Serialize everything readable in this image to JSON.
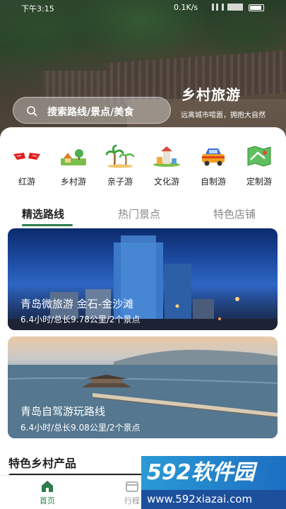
{
  "status_bar": {
    "time": "下午3:15",
    "network": "0.1K/s"
  },
  "hero": {
    "title": "乡村旅游",
    "subtitle": "远离城市喧嚣，拥抱大自然"
  },
  "search": {
    "placeholder": "搜索路线/景点/美食"
  },
  "categories": [
    {
      "label": "红游",
      "icon": "red-tour-icon"
    },
    {
      "label": "乡村游",
      "icon": "village-icon"
    },
    {
      "label": "亲子游",
      "icon": "palm-tree-icon"
    },
    {
      "label": "文化游",
      "icon": "culture-icon"
    },
    {
      "label": "自制游",
      "icon": "car-icon"
    },
    {
      "label": "定制游",
      "icon": "map-icon"
    }
  ],
  "tabs": [
    {
      "label": "精选路线",
      "active": true
    },
    {
      "label": "热门景点",
      "active": false
    },
    {
      "label": "特色店铺",
      "active": false
    }
  ],
  "routes": [
    {
      "title": "青岛微旅游 金石-金沙滩",
      "meta": "6.4小时/总长9.78公里/2个景点"
    },
    {
      "title": "青岛自驾游玩路线",
      "meta": "6.4小时/总长9.08公里/2个景点"
    }
  ],
  "section": {
    "title": "特色乡村产品"
  },
  "tabbar": [
    {
      "label": "首页",
      "icon": "home-icon",
      "active": true
    },
    {
      "label": "行程",
      "icon": "itinerary-icon",
      "active": false
    }
  ],
  "watermark": {
    "brand": "592软件园",
    "url": "www.592xiazai.com"
  },
  "colors": {
    "accent": "#2e7d4f"
  }
}
